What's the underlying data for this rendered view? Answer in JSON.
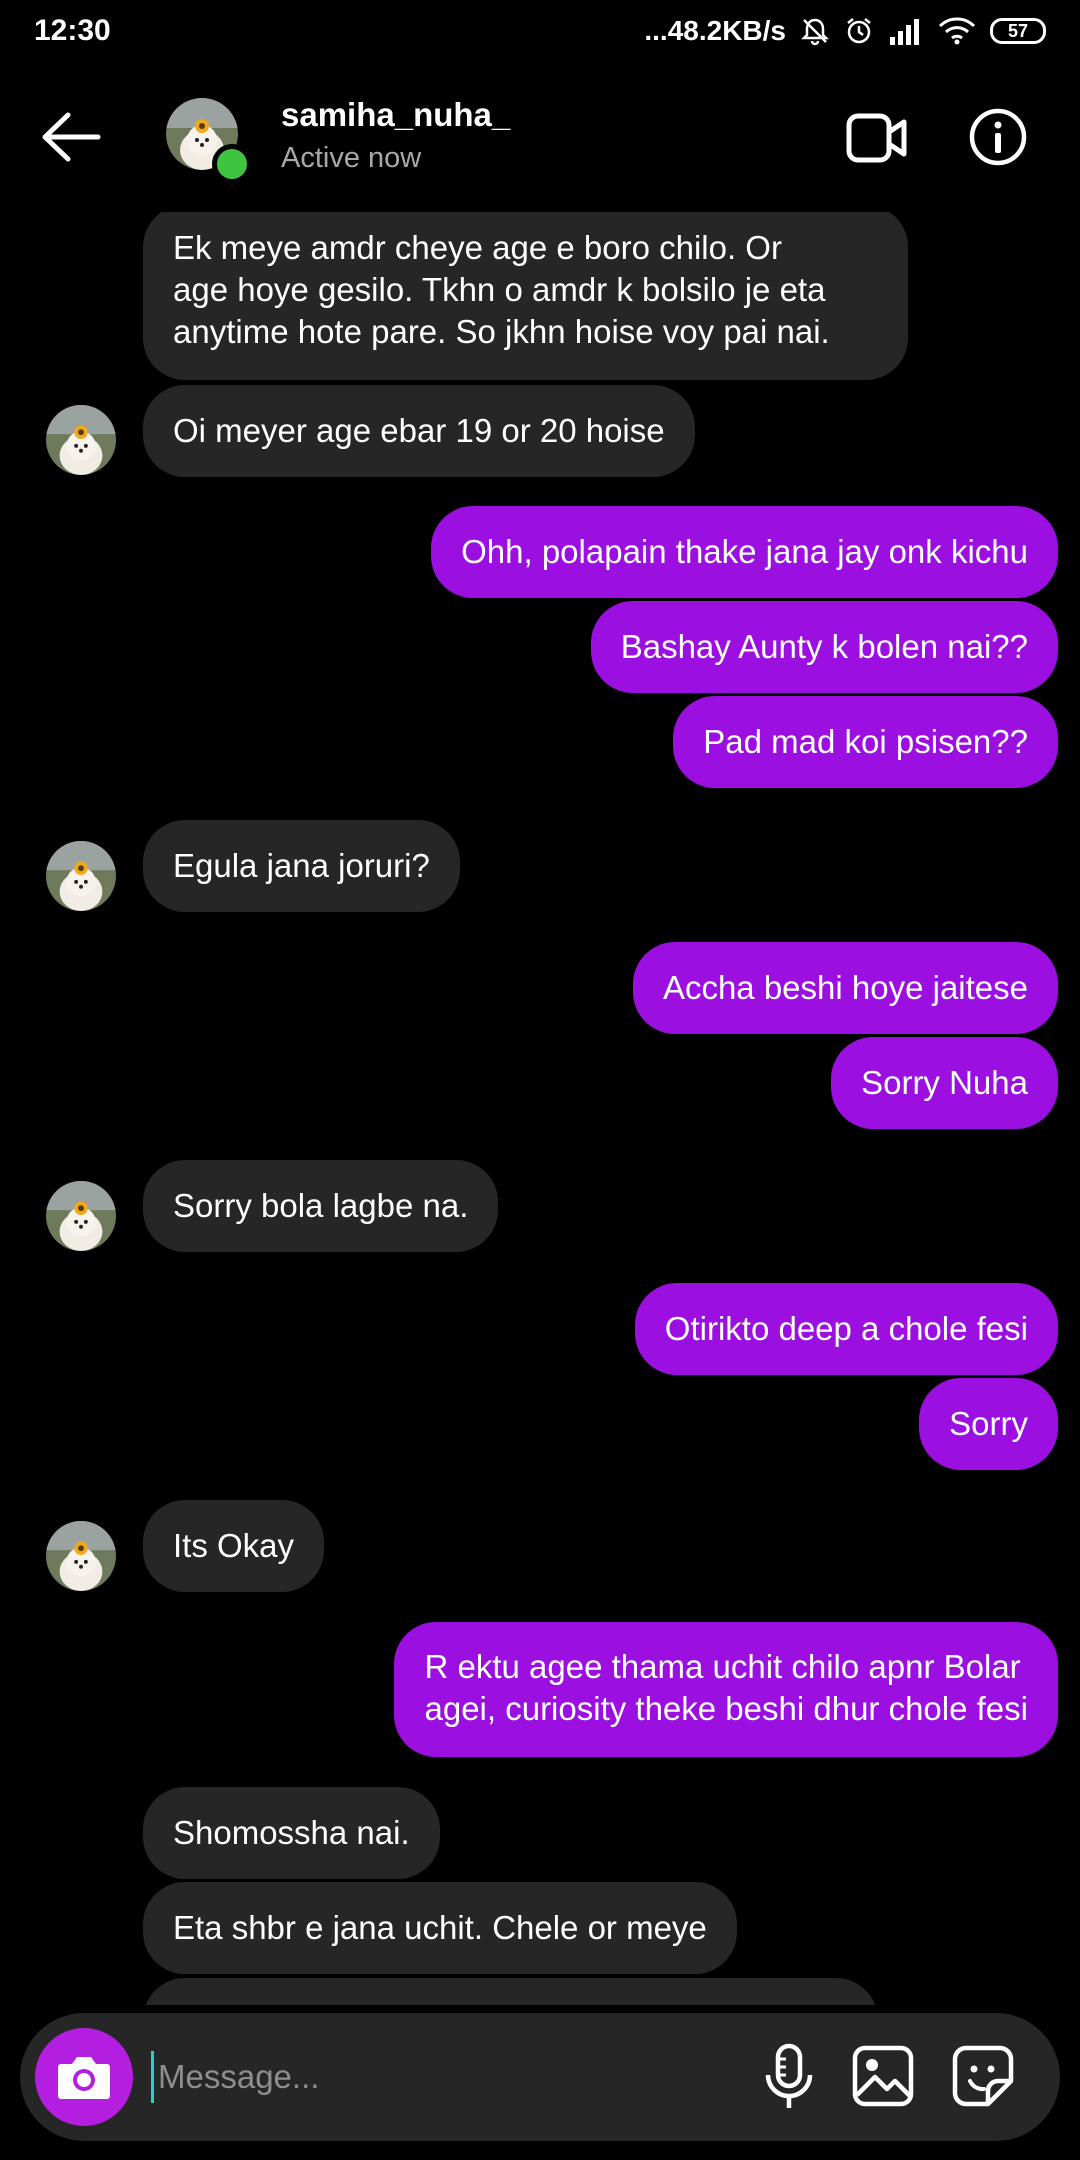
{
  "status_bar": {
    "time": "12:30",
    "network_speed": "...48.2KB/s",
    "battery": "57",
    "icons": [
      "mute-bell-icon",
      "alarm-icon",
      "signal-icon",
      "wifi-icon",
      "battery-icon"
    ]
  },
  "header": {
    "username": "samiha_nuha_",
    "status": "Active now",
    "icons": [
      "back-arrow-icon",
      "video-call-icon",
      "info-icon"
    ],
    "online_color": "#3ec43e"
  },
  "messages": [
    {
      "side": "in",
      "lines": [
        "Ek meye amdr cheye age e  boro chilo. Or",
        "age hoye gesilo. Tkhn o amdr k bolsilo je eta",
        "anytime hote pare. So jkhn hoise voy pai nai."
      ]
    },
    {
      "side": "in",
      "lines": [
        "Oi meyer age ebar 19 or 20 hoise"
      ]
    },
    {
      "side": "out",
      "lines": [
        "Ohh, polapain thake jana jay onk kichu"
      ]
    },
    {
      "side": "out",
      "lines": [
        "Bashay Aunty k bolen nai??"
      ]
    },
    {
      "side": "out",
      "lines": [
        "Pad mad koi psisen??"
      ]
    },
    {
      "side": "in",
      "lines": [
        "Egula jana joruri?"
      ]
    },
    {
      "side": "out",
      "lines": [
        "Accha beshi hoye jaitese"
      ]
    },
    {
      "side": "out",
      "lines": [
        "Sorry Nuha"
      ]
    },
    {
      "side": "in",
      "lines": [
        "Sorry bola lagbe na."
      ]
    },
    {
      "side": "out",
      "lines": [
        "Otirikto deep a chole fesi"
      ]
    },
    {
      "side": "out",
      "lines": [
        "Sorry"
      ]
    },
    {
      "side": "in",
      "lines": [
        "Its Okay"
      ]
    },
    {
      "side": "out",
      "lines": [
        "R ektu agee thama uchit chilo apnr Bolar",
        "agei, curiosity theke beshi dhur chole fesi"
      ]
    },
    {
      "side": "in",
      "lines": [
        "Shomossha nai."
      ]
    },
    {
      "side": "in",
      "lines": [
        "Eta shbr e jana uchit. Chele or meye"
      ]
    },
    {
      "side": "in",
      "lines": [
        ""
      ]
    }
  ],
  "composer": {
    "placeholder": "Message...",
    "icons": [
      "camera-icon",
      "microphone-icon",
      "gallery-icon",
      "sticker-icon"
    ]
  },
  "colors": {
    "incoming_bubble": "#262626",
    "outgoing_bubble": "#9b0fe0",
    "camera_button": "#b31ee0",
    "background": "#000000"
  }
}
